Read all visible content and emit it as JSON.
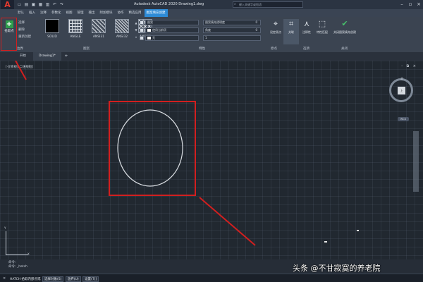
{
  "app": {
    "logo_letter": "A",
    "window_title": "Autodesk AutoCAD 2020    Drawing1.dwg",
    "search_placeholder": "键入关键字或短语"
  },
  "ribbon_tabs": [
    "默认",
    "插入",
    "注释",
    "参数化",
    "视图",
    "管理",
    "输出",
    "附加模块",
    "协作",
    "精选应用",
    "图案填充创建"
  ],
  "ribbon": {
    "pick_points_label": "拾取点",
    "boundary_rows": [
      "选择",
      "删除",
      "重新创建"
    ],
    "boundaries_group": "边界",
    "pattern_group": "图案",
    "patterns": [
      "SOLID",
      "ANGLE",
      "ANSI31",
      "ANSI32",
      "ANSI33"
    ],
    "props": {
      "type": "图案",
      "color": "使用当前项",
      "bg": "无",
      "transparency_label": "图案填充透明度",
      "transparency_value": "0",
      "angle_label": "角度",
      "angle_value": "0",
      "scale_value": "1"
    },
    "properties_group": "特性",
    "set_origin_label": "设定原点",
    "origin_group": "原点",
    "associative_label": "关联",
    "annotative_label": "注释性",
    "match_label": "特性匹配",
    "options_group": "选项",
    "close_label": "关闭图案填充创建",
    "close_group": "关闭"
  },
  "doc_tabs": [
    "开始",
    "Drawing1*"
  ],
  "canvas": {
    "viewport_label": "[-][俯视][二维线框]",
    "view_controls": "- ⧉ ×",
    "viewcube_face": "上",
    "viewcube_north": "北",
    "wcs_label": "WCS",
    "ucs_x": "X",
    "ucs_y": "Y",
    "circle_stroke": "#d9dde2"
  },
  "command": {
    "history": [
      "命令:",
      "命令: _hatch"
    ],
    "prompt": "HATCH 拾取内部点或",
    "options": [
      "选择对象(S)",
      "放弃(U)",
      "设置(T)]"
    ]
  },
  "watermark": "头条 @不甘寂寞的养老院",
  "colors": {
    "annotation_red": "#d21f1f",
    "active_tab_blue": "#2e8bd6",
    "canvas_bg": "#212830"
  }
}
